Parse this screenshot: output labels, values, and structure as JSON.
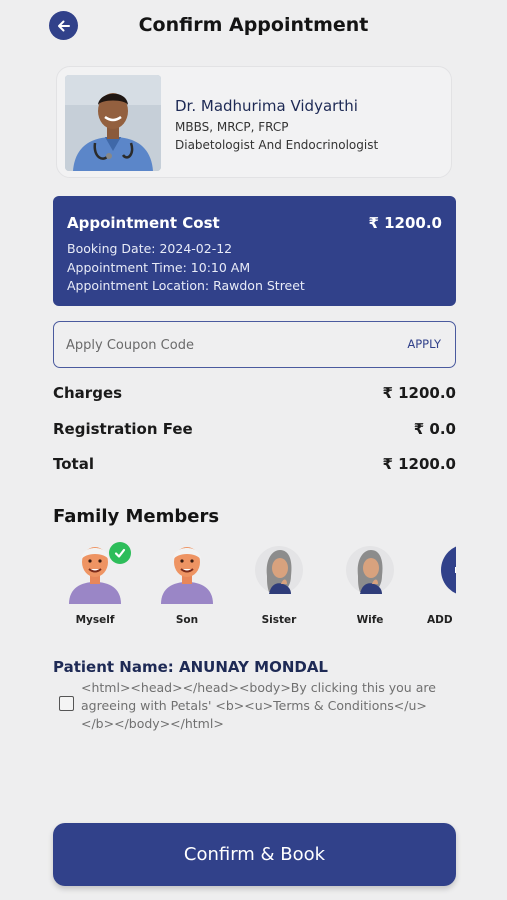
{
  "header": {
    "title": "Confirm Appointment",
    "back_icon": "arrow-left-icon"
  },
  "doctor": {
    "name": "Dr. Madhurima Vidyarthi",
    "degree": "MBBS, MRCP, FRCP",
    "specialization": "Diabetologist And Endocrinologist"
  },
  "appointment": {
    "cost_label": "Appointment Cost",
    "cost_value": "₹ 1200.0",
    "booking_date": "Booking Date: 2024-02-12",
    "time": "Appointment Time: 10:10 AM",
    "location": "Appointment Location: Rawdon Street"
  },
  "coupon": {
    "placeholder": "Apply Coupon Code",
    "apply_label": "APPLY"
  },
  "charges": [
    {
      "label": "Charges",
      "value": "₹ 1200.0"
    },
    {
      "label": "Registration Fee",
      "value": "₹ 0.0"
    },
    {
      "label": "Total",
      "value": "₹ 1200.0"
    }
  ],
  "family": {
    "title": "Family Members",
    "members": [
      {
        "name": "Myself",
        "selected": true
      },
      {
        "name": "Son",
        "selected": false
      },
      {
        "name": "Sister",
        "selected": false
      },
      {
        "name": "Wife",
        "selected": false
      },
      {
        "name": "ADD NEW",
        "selected": false
      }
    ]
  },
  "patient": {
    "label": "Patient Name:",
    "name": "ANUNAY MONDAL"
  },
  "terms": {
    "text": "<html><head></head><body>By clicking this you are agreeing with Petals' <b><u>Terms & Conditions</u></b></body></html>"
  },
  "footer": {
    "confirm_label": "Confirm & Book"
  },
  "colors": {
    "primary": "#31418a",
    "selected": "#2dbd5a",
    "background": "#eeeeef"
  }
}
